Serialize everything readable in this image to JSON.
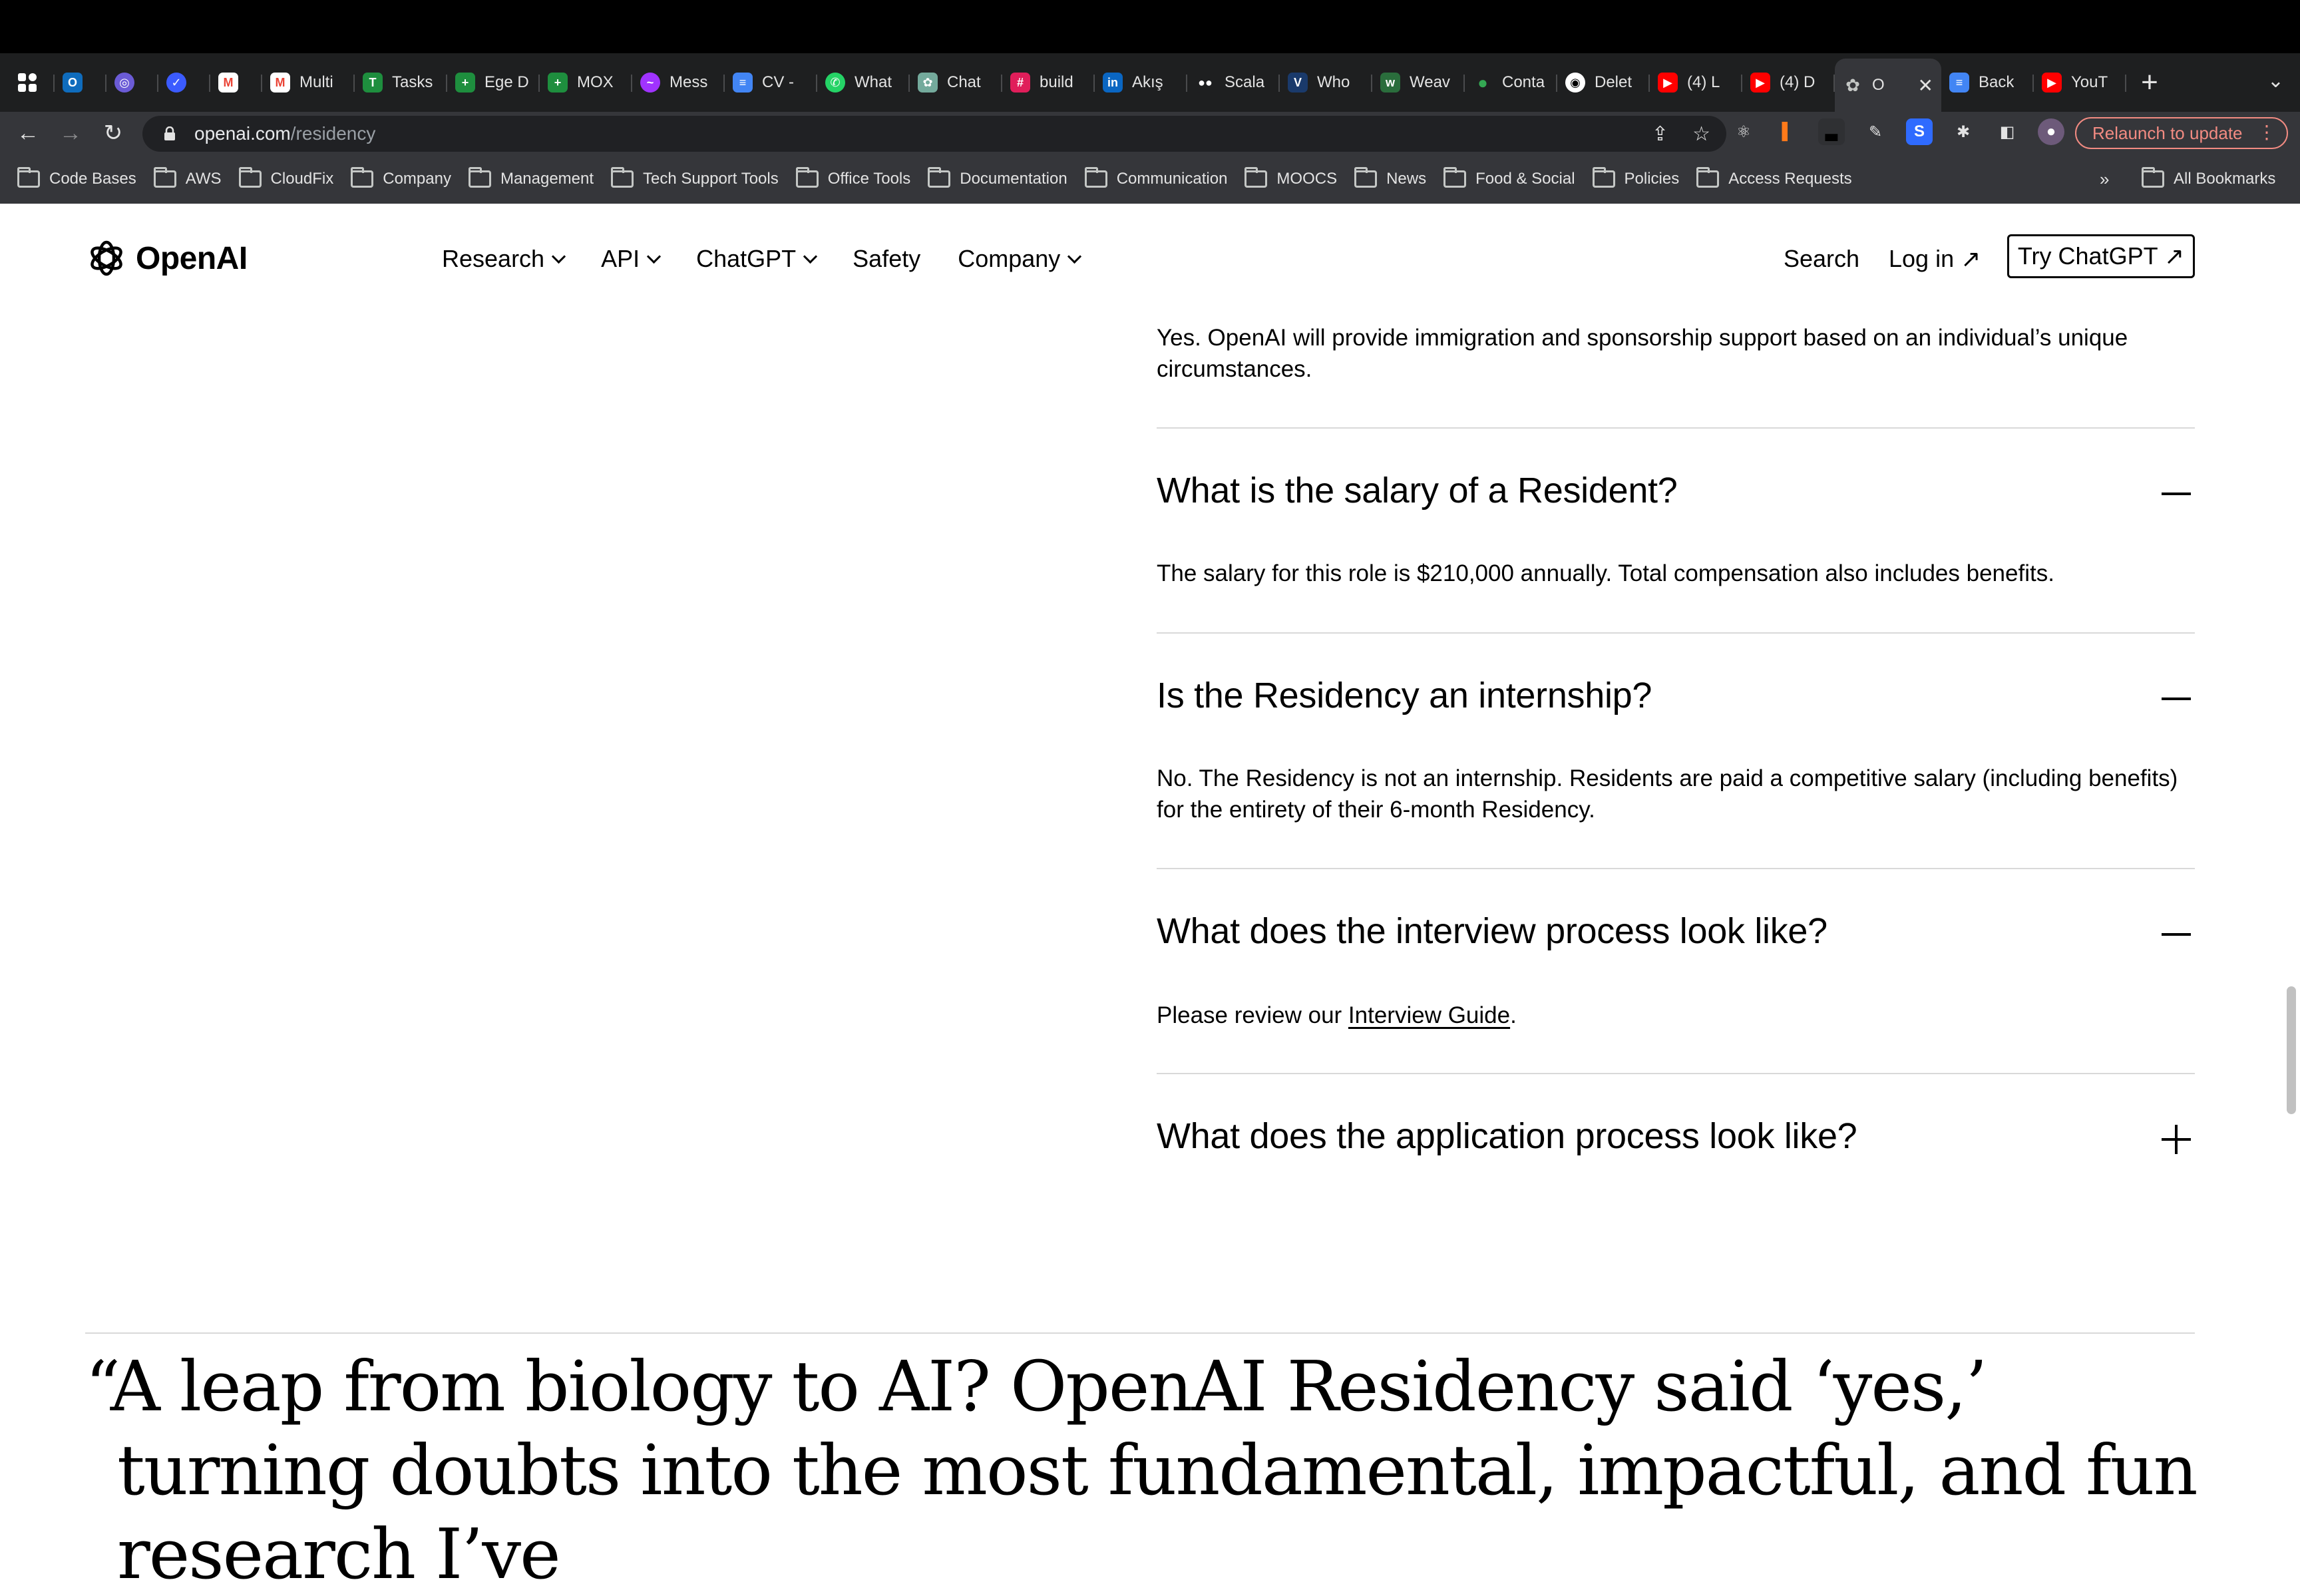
{
  "browser": {
    "tabs": [
      {
        "title": "",
        "icon": "app-grid-icon",
        "color": "#ffffff"
      },
      {
        "title": "",
        "icon": "outlook-icon",
        "color": "#0f6cbd"
      },
      {
        "title": "",
        "icon": "circle-logo-icon",
        "color": "#6b5bd6"
      },
      {
        "title": "",
        "icon": "clockify-icon",
        "color": "#3b5bff"
      },
      {
        "title": "",
        "icon": "gmail-icon",
        "color": "#ea4335"
      },
      {
        "title": "Multi",
        "icon": "gmail-icon",
        "color": "#ea4335"
      },
      {
        "title": "Tasks",
        "icon": "tasks-icon",
        "color": "#1e8e3e"
      },
      {
        "title": "Ege D",
        "icon": "sheets-icon",
        "color": "#1e8e3e"
      },
      {
        "title": "MOX",
        "icon": "sheets-icon",
        "color": "#1e8e3e"
      },
      {
        "title": "Mess",
        "icon": "messenger-icon",
        "color": "#a033ff"
      },
      {
        "title": "CV -",
        "icon": "docs-icon",
        "color": "#4285f4"
      },
      {
        "title": "What",
        "icon": "whatsapp-icon",
        "color": "#25d366"
      },
      {
        "title": "Chat",
        "icon": "chatgpt-icon",
        "color": "#74aa9c"
      },
      {
        "title": "build",
        "icon": "slack-icon",
        "color": "#e01e5a"
      },
      {
        "title": "Akış",
        "icon": "linkedin-icon",
        "color": "#0a66c2"
      },
      {
        "title": "Scala",
        "icon": "medium-icon",
        "color": "#000000"
      },
      {
        "title": "Who",
        "icon": "v-logo-icon",
        "color": "#1a3a6b"
      },
      {
        "title": "Weav",
        "icon": "weave-icon",
        "color": "#2a6d3c"
      },
      {
        "title": "Conta",
        "icon": "green-dot-icon",
        "color": "#34a853"
      },
      {
        "title": "Delet",
        "icon": "github-icon",
        "color": "#ffffff"
      },
      {
        "title": "(4) L",
        "icon": "youtube-icon",
        "color": "#ff0000"
      },
      {
        "title": "(4) D",
        "icon": "youtube-icon",
        "color": "#ff0000"
      },
      {
        "title": "O",
        "icon": "openai-icon",
        "color": "#c4c7c5",
        "active": true
      },
      {
        "title": "Back",
        "icon": "docs-icon",
        "color": "#4285f4"
      },
      {
        "title": "YouT",
        "icon": "youtube-icon",
        "color": "#ff0000"
      }
    ],
    "new_tab_label": "+",
    "url_host": "openai.com",
    "url_path": "/residency",
    "relaunch_label": "Relaunch to update",
    "bookmarks": [
      "Code Bases",
      "AWS",
      "CloudFix",
      "Company",
      "Management",
      "Tech Support Tools",
      "Office Tools",
      "Documentation",
      "Communication",
      "MOOCS",
      "News",
      "Food & Social",
      "Policies",
      "Access Requests"
    ],
    "bookmarks_more": "»",
    "all_bookmarks": "All Bookmarks"
  },
  "header": {
    "logo_text": "OpenAI",
    "nav": [
      "Research",
      "API",
      "ChatGPT",
      "Safety",
      "Company"
    ],
    "search_label": "Search",
    "login_label": "Log in ↗",
    "cta_label": "Try ChatGPT ↗"
  },
  "faq": {
    "top_answer": "Yes. OpenAI will provide immigration and sponsorship support based on an individual’s unique circumstances.",
    "items": [
      {
        "question": "What is the salary of a Resident?",
        "answer": "The salary for this role is $210,000 annually. Total compensation also includes benefits.",
        "expanded": true
      },
      {
        "question": "Is the Residency an internship?",
        "answer": "No. The Residency is not an internship. Residents are paid a competitive salary (including benefits) for the entirety of their 6-month Residency.",
        "expanded": true
      },
      {
        "question": "What does the interview process look like?",
        "answer_prefix": "Please review our ",
        "answer_link": "Interview Guide",
        "answer_suffix": ".",
        "expanded": true
      },
      {
        "question": "What does the application process look like?",
        "expanded": false
      }
    ]
  },
  "quote": {
    "text": "“A leap from biology to AI? OpenAI Residency said ‘yes,’ turning doubts into the most fundamental, impactful, and fun research I’ve"
  }
}
